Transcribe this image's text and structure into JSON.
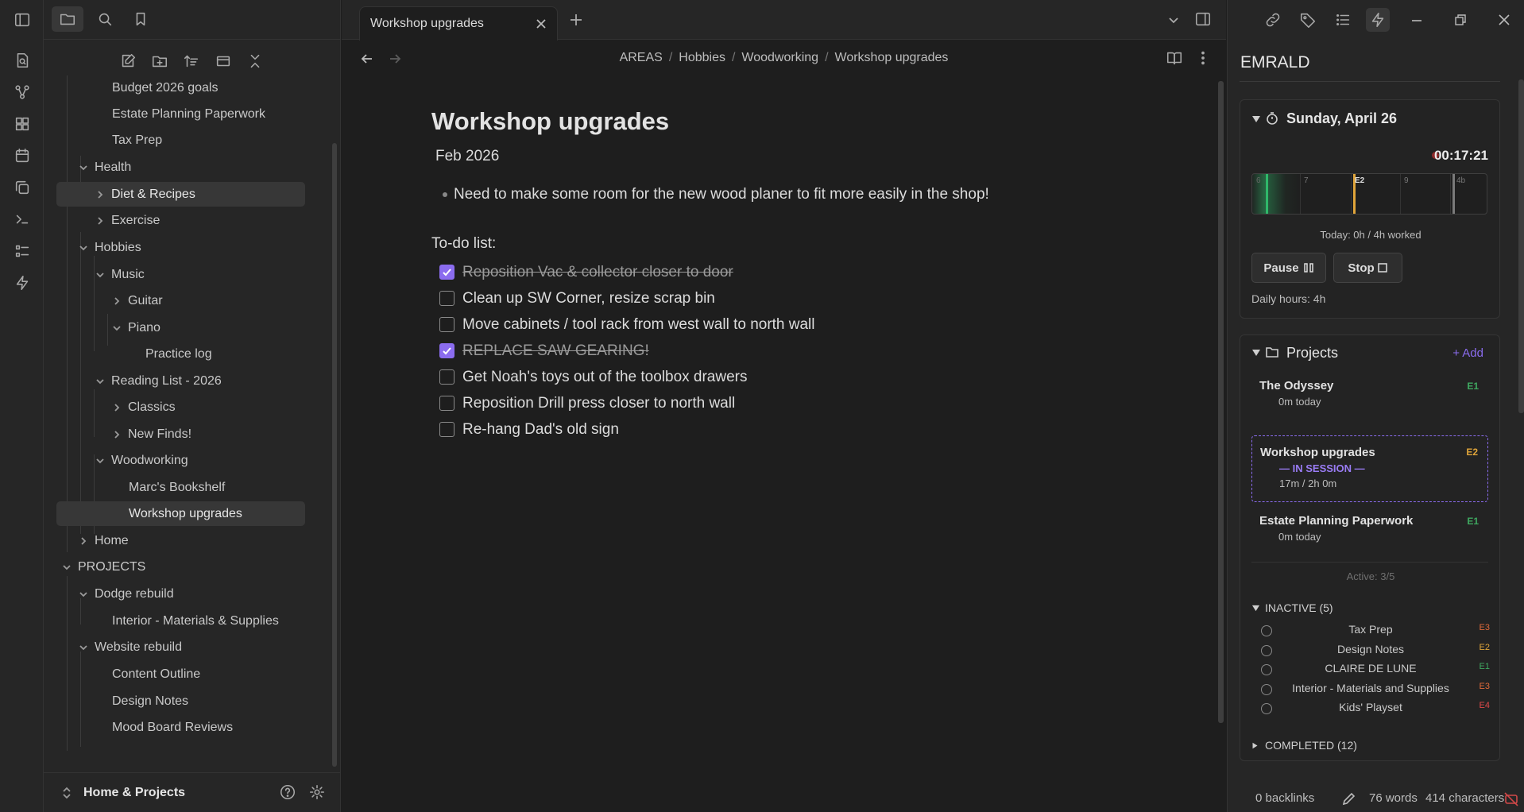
{
  "sidebar": {
    "tree": [
      {
        "label": "Budget 2026 goals"
      },
      {
        "label": "Estate Planning Paperwork"
      },
      {
        "label": "Tax Prep"
      },
      {
        "label": "Health"
      },
      {
        "label": "Diet & Recipes"
      },
      {
        "label": "Exercise"
      },
      {
        "label": "Hobbies"
      },
      {
        "label": "Music"
      },
      {
        "label": "Guitar"
      },
      {
        "label": "Piano"
      },
      {
        "label": "Practice log"
      },
      {
        "label": "Reading List - 2026"
      },
      {
        "label": "Classics"
      },
      {
        "label": "New Finds!"
      },
      {
        "label": "Woodworking"
      },
      {
        "label": "Marc's Bookshelf"
      },
      {
        "label": "Workshop upgrades"
      },
      {
        "label": "Home"
      },
      {
        "label": "PROJECTS"
      },
      {
        "label": "Dodge rebuild"
      },
      {
        "label": "Interior - Materials & Supplies"
      },
      {
        "label": "Website rebuild"
      },
      {
        "label": "Content Outline"
      },
      {
        "label": "Design Notes"
      },
      {
        "label": "Mood Board Reviews"
      }
    ],
    "vault_name": "Home & Projects"
  },
  "tab": {
    "title": "Workshop upgrades"
  },
  "breadcrumb": [
    "AREAS",
    "Hobbies",
    "Woodworking",
    "Workshop upgrades"
  ],
  "note": {
    "title": "Workshop upgrades",
    "date": "Feb 2026",
    "bullet": "Need to make some room for the new wood planer to fit more easily in the shop!",
    "todo_heading": "To-do list:",
    "tasks": [
      {
        "text": "Reposition Vac & collector closer to door",
        "done": true
      },
      {
        "text": "Clean up SW Corner, resize scrap bin",
        "done": false
      },
      {
        "text": "Move cabinets / tool rack from west wall to north wall",
        "done": false
      },
      {
        "text": "REPLACE SAW GEARING!",
        "done": true
      },
      {
        "text": "Get Noah's toys out of the toolbox drawers",
        "done": false
      },
      {
        "text": "Reposition Drill press closer to north wall",
        "done": false
      },
      {
        "text": "Re-hang Dad's old sign",
        "done": false
      }
    ]
  },
  "panel": {
    "title": "EMRALD",
    "timer": {
      "date": "Sunday, April 26",
      "elapsed": "00:17:21",
      "ticks": [
        "6",
        "7",
        "E2",
        "9",
        "4b"
      ],
      "today": "Today: 0h / 4h worked",
      "pause_label": "Pause",
      "stop_label": "Stop",
      "daily_hours": "Daily hours: 4h"
    },
    "projects": {
      "heading": "Projects",
      "add_label": "+ Add",
      "active": [
        {
          "name": "The Odyssey",
          "sub": "0m today",
          "tag": "E1",
          "tag_color": "#3fa860"
        },
        {
          "name": "Workshop upgrades",
          "in_session": "— IN SESSION —",
          "sub": "17m / 2h 0m",
          "tag": "E2",
          "tag_color": "#e0a53a"
        },
        {
          "name": "Estate Planning Paperwork",
          "sub": "0m today",
          "tag": "E1",
          "tag_color": "#3fa860"
        }
      ],
      "active_count": "Active: 3/5",
      "inactive_heading": "INACTIVE (5)",
      "inactive": [
        {
          "name": "Tax Prep",
          "tag": "E3",
          "tag_color": "#e06a3a"
        },
        {
          "name": "Design Notes",
          "tag": "E2",
          "tag_color": "#e0a53a"
        },
        {
          "name": "CLAIRE DE LUNE",
          "tag": "E1",
          "tag_color": "#3fa860"
        },
        {
          "name": "Interior - Materials and Supplies",
          "tag": "E3",
          "tag_color": "#e06a3a"
        },
        {
          "name": "Kids' Playset",
          "tag": "E4",
          "tag_color": "#e04a4a"
        }
      ],
      "completed_heading": "COMPLETED (12)"
    }
  },
  "status": {
    "backlinks": "0 backlinks",
    "words": "76 words",
    "characters": "414 characters"
  },
  "colors": {
    "accent": "#8b6cef",
    "session": "#9a7cf5",
    "timer_green": "#2fb86a",
    "timer_marker": "#e0a53a"
  }
}
